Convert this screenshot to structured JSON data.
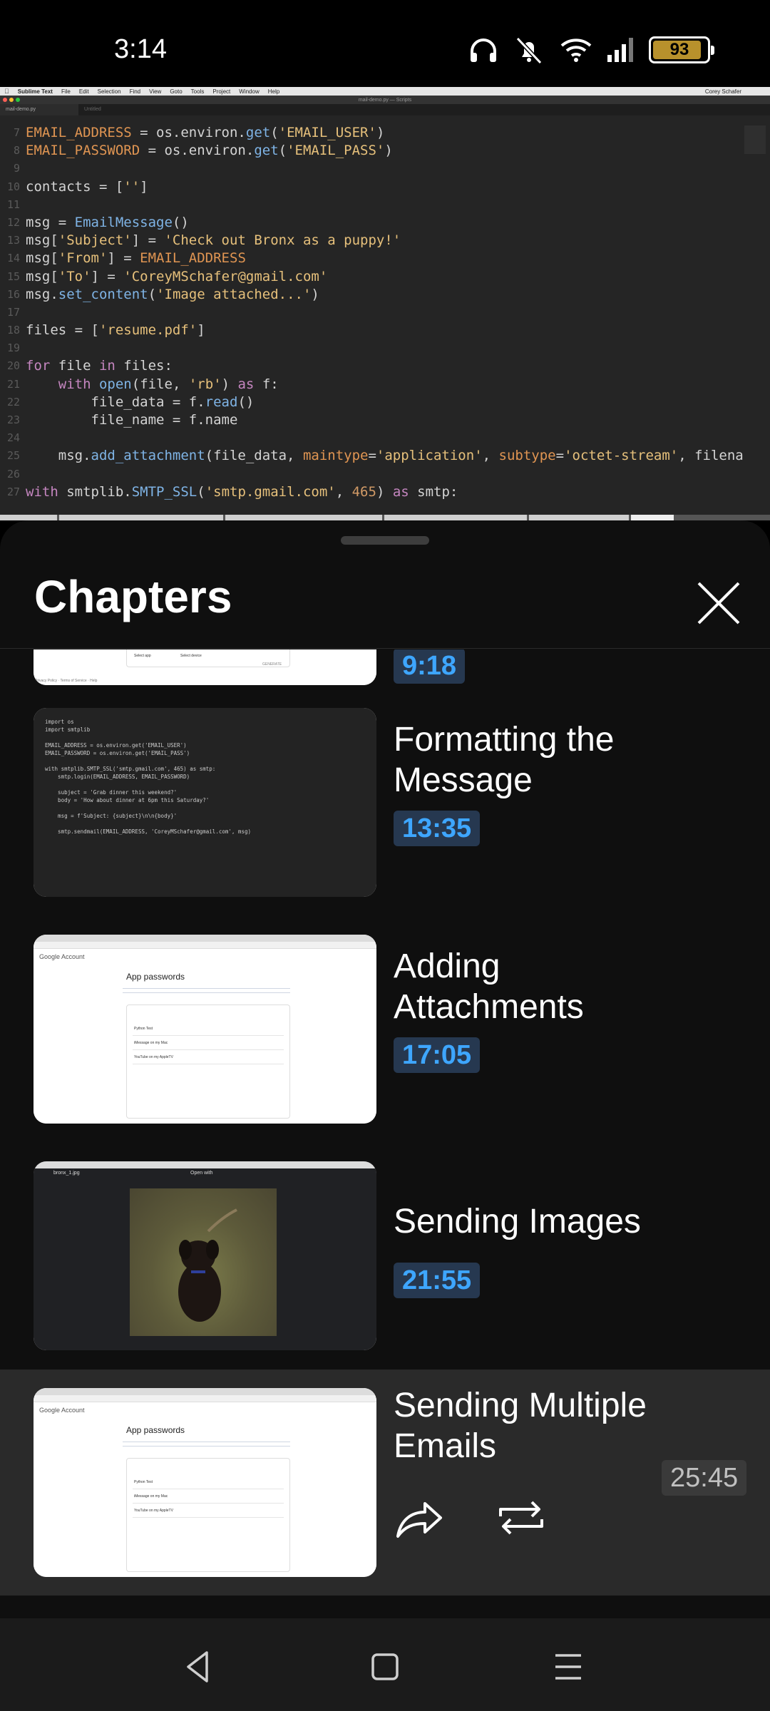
{
  "status_bar": {
    "time": "3:14",
    "battery": "93",
    "icons": [
      "headphones-icon",
      "mute-vibrate-icon",
      "wifi-icon",
      "signal-icon",
      "battery-icon"
    ]
  },
  "video": {
    "menubar": {
      "app": "Sublime Text",
      "items": [
        "File",
        "Edit",
        "Selection",
        "Find",
        "View",
        "Goto",
        "Tools",
        "Project",
        "Window",
        "Help"
      ],
      "user": "Corey Schafer"
    },
    "window_title": "mail-demo.py — Scripts",
    "tabs": [
      "mail-demo.py",
      "Untitled"
    ],
    "code_lines": [
      {
        "n": "7",
        "text": "EMAIL_ADDRESS = os.environ.get('EMAIL_USER')"
      },
      {
        "n": "8",
        "text": "EMAIL_PASSWORD = os.environ.get('EMAIL_PASS')"
      },
      {
        "n": "9",
        "text": ""
      },
      {
        "n": "10",
        "text": "contacts = ['']"
      },
      {
        "n": "11",
        "text": ""
      },
      {
        "n": "12",
        "text": "msg = EmailMessage()"
      },
      {
        "n": "13",
        "text": "msg['Subject'] = 'Check out Bronx as a puppy!'"
      },
      {
        "n": "14",
        "text": "msg['From'] = EMAIL_ADDRESS"
      },
      {
        "n": "15",
        "text": "msg['To'] = 'CoreyMSchafer@gmail.com'"
      },
      {
        "n": "16",
        "text": "msg.set_content('Image attached...')"
      },
      {
        "n": "17",
        "text": ""
      },
      {
        "n": "18",
        "text": "files = ['resume.pdf']"
      },
      {
        "n": "19",
        "text": ""
      },
      {
        "n": "20",
        "text": "for file in files:"
      },
      {
        "n": "21",
        "text": "    with open(file, 'rb') as f:"
      },
      {
        "n": "22",
        "text": "        file_data = f.read()"
      },
      {
        "n": "23",
        "text": "        file_name = f.name"
      },
      {
        "n": "24",
        "text": ""
      },
      {
        "n": "25",
        "text": "    msg.add_attachment(file_data, maintype='application', subtype='octet-stream', filena"
      },
      {
        "n": "26",
        "text": ""
      },
      {
        "n": "27",
        "text": "with smtplib.SMTP_SSL('smtp.gmail.com', 465) as smtp:"
      }
    ]
  },
  "panel": {
    "title": "Chapters",
    "close_icon": "close-icon"
  },
  "chapters": [
    {
      "title": "",
      "time": "9:18",
      "thumb": "app-passwords"
    },
    {
      "title": "Formatting the Message",
      "time": "13:35",
      "thumb": "code"
    },
    {
      "title": "Adding Attachments",
      "time": "17:05",
      "thumb": "app-passwords"
    },
    {
      "title": "Sending Images",
      "time": "21:55",
      "thumb": "dog-photo"
    },
    {
      "title": "Sending Multiple Emails",
      "time": "25:45",
      "thumb": "app-passwords",
      "active": true
    }
  ],
  "thumb_code": "import os\nimport smtplib\n\nEMAIL_ADDRESS = os.environ.get('EMAIL_USER')\nEMAIL_PASSWORD = os.environ.get('EMAIL_PASS')\n\nwith smtplib.SMTP_SSL('smtp.gmail.com', 465) as smtp:\n    smtp.login(EMAIL_ADDRESS, EMAIL_PASSWORD)\n\n    subject = 'Grab dinner this weekend?'\n    body = 'How about dinner at 6pm this Saturday?'\n\n    msg = f'Subject: {subject}\\n\\n{body}'\n\n    smtp.sendmail(EMAIL_ADDRESS, 'CoreyMSchafer@gmail.com', msg)",
  "thumb_google": {
    "account": "Google Account",
    "title": "App passwords",
    "rows": [
      "Python Test",
      "iMessage on my Mac",
      "YouTube on my AppleTV"
    ]
  },
  "thumb_photo_viewer": {
    "file": "bronx_1.jpg",
    "open_with": "Open with"
  },
  "nav": {
    "icons": [
      "back-icon",
      "home-icon",
      "recents-icon"
    ]
  },
  "colors": {
    "accent_blue": "#3ea6ff",
    "time_badge_bg": "#263850",
    "panel_bg": "#0f0f0f",
    "active_row_bg": "#2a2a2a",
    "battery_fill": "#b8912c"
  }
}
